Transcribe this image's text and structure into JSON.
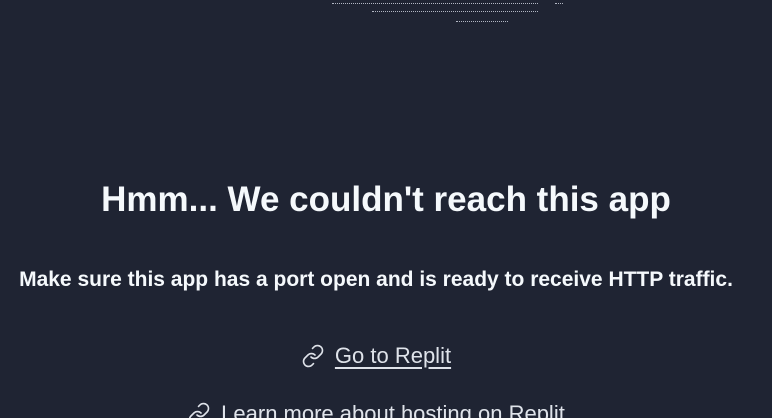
{
  "colors": {
    "background": "#1f2433",
    "text": "#f5f9fc",
    "link": "#dfe3ea"
  },
  "error": {
    "title": "Hmm... We couldn't reach this app",
    "message": "Make sure this app has a port open and is ready to receive HTTP traffic."
  },
  "links": [
    {
      "label": "Go to Replit",
      "icon": "link-icon"
    },
    {
      "label": "Learn more about hosting on Replit",
      "icon": "link-icon"
    }
  ]
}
